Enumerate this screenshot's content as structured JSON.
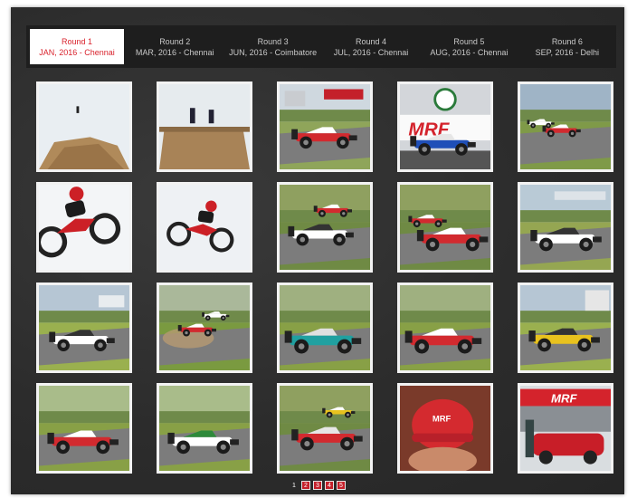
{
  "tabs": [
    {
      "round": "Round 1",
      "info": "JAN, 2016 - Chennai"
    },
    {
      "round": "Round 2",
      "info": "MAR, 2016 - Chennai"
    },
    {
      "round": "Round 3",
      "info": "JUN, 2016 - Coimbatore"
    },
    {
      "round": "Round 4",
      "info": "JUL, 2016 - Chennai"
    },
    {
      "round": "Round 5",
      "info": "AUG, 2016 - Chennai"
    },
    {
      "round": "Round 6",
      "info": "SEP, 2016 - Delhi"
    }
  ],
  "active_tab": 0,
  "gallery": [
    {
      "subject": "motocross jump"
    },
    {
      "subject": "motocross riders on ramp"
    },
    {
      "subject": "red formula car"
    },
    {
      "subject": "blue formula car MRF"
    },
    {
      "subject": "cars on track"
    },
    {
      "subject": "motocross bike stunt"
    },
    {
      "subject": "motocross aerial"
    },
    {
      "subject": "formula cars racing"
    },
    {
      "subject": "red formula car"
    },
    {
      "subject": "formula car on track"
    },
    {
      "subject": "white formula car"
    },
    {
      "subject": "car running wide"
    },
    {
      "subject": "teal formula car"
    },
    {
      "subject": "red formula car"
    },
    {
      "subject": "yellow formula car"
    },
    {
      "subject": "red formula car"
    },
    {
      "subject": "white green formula car"
    },
    {
      "subject": "formula cars racing"
    },
    {
      "subject": "fan in red cap"
    },
    {
      "subject": "MRF sedan"
    }
  ],
  "pagination": {
    "pages": [
      "1",
      "2",
      "3",
      "4",
      "5"
    ],
    "current": 0
  },
  "colors": {
    "accent": "#d9232d",
    "tab_bar": "#1e1e1e",
    "background": "#2e2e2e"
  }
}
